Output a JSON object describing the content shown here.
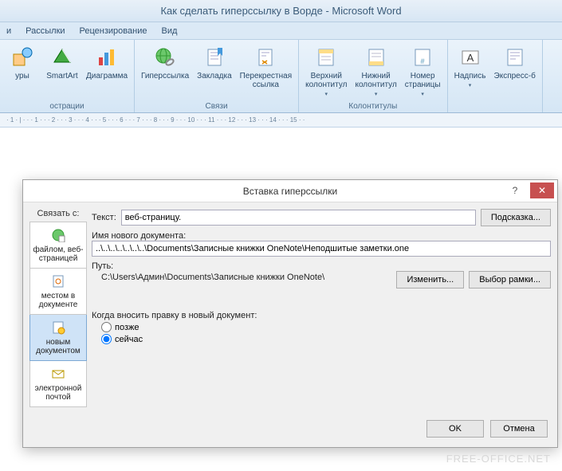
{
  "window": {
    "title": "Как сделать гиперссылку в Ворде - Microsoft Word"
  },
  "tabs": {
    "t0": "и",
    "t1": "Рассылки",
    "t2": "Рецензирование",
    "t3": "Вид"
  },
  "ribbon": {
    "g1": {
      "label": "острации",
      "b1": "уры",
      "b2": "SmartArt",
      "b3": "Диаграмма"
    },
    "g2": {
      "label": "Связи",
      "b1": "Гиперссылка",
      "b2": "Закладка",
      "b3": "Перекрестная\nссылка"
    },
    "g3": {
      "label": "Колонтитулы",
      "b1": "Верхний\nколонтитул",
      "b2": "Нижний\nколонтитул",
      "b3": "Номер\nстраницы"
    },
    "g4": {
      "b1": "Надпись",
      "b2": "Экспресс-б"
    }
  },
  "ruler": "· 1 · | · · · 1 · · · 2 · · · 3 · · · 4 · · · 5 · · · 6 · · · 7 · · · 8 · · · 9 · · · 10 · · · 11 · · · 12 · · · 13 · · · 14 · · · 15 · ·",
  "dialog": {
    "title": "Вставка гиперссылки",
    "link_to": "Связать с:",
    "lt1": "файлом, веб-\nстраницей",
    "lt2": "местом в\nдокументе",
    "lt3": "новым\nдокументом",
    "lt4": "электронной\nпочтой",
    "text_label": "Текст:",
    "text_value": "веб-страницу.",
    "tooltip_btn": "Подсказка...",
    "newdoc_label": "Имя нового документа:",
    "newdoc_value": "..\\..\\..\\..\\..\\..\\..\\Documents\\Записные книжки OneNote\\Неподшитые заметки.one",
    "path_label": "Путь:",
    "path_value": "C:\\Users\\Админ\\Documents\\Записные книжки OneNote\\",
    "change_btn": "Изменить...",
    "frame_btn": "Выбор рамки...",
    "when_label": "Когда вносить правку в новый документ:",
    "later": "позже",
    "now": "сейчас",
    "ok": "OK",
    "cancel": "Отмена"
  },
  "watermark": "FREE-OFFICE.NET"
}
